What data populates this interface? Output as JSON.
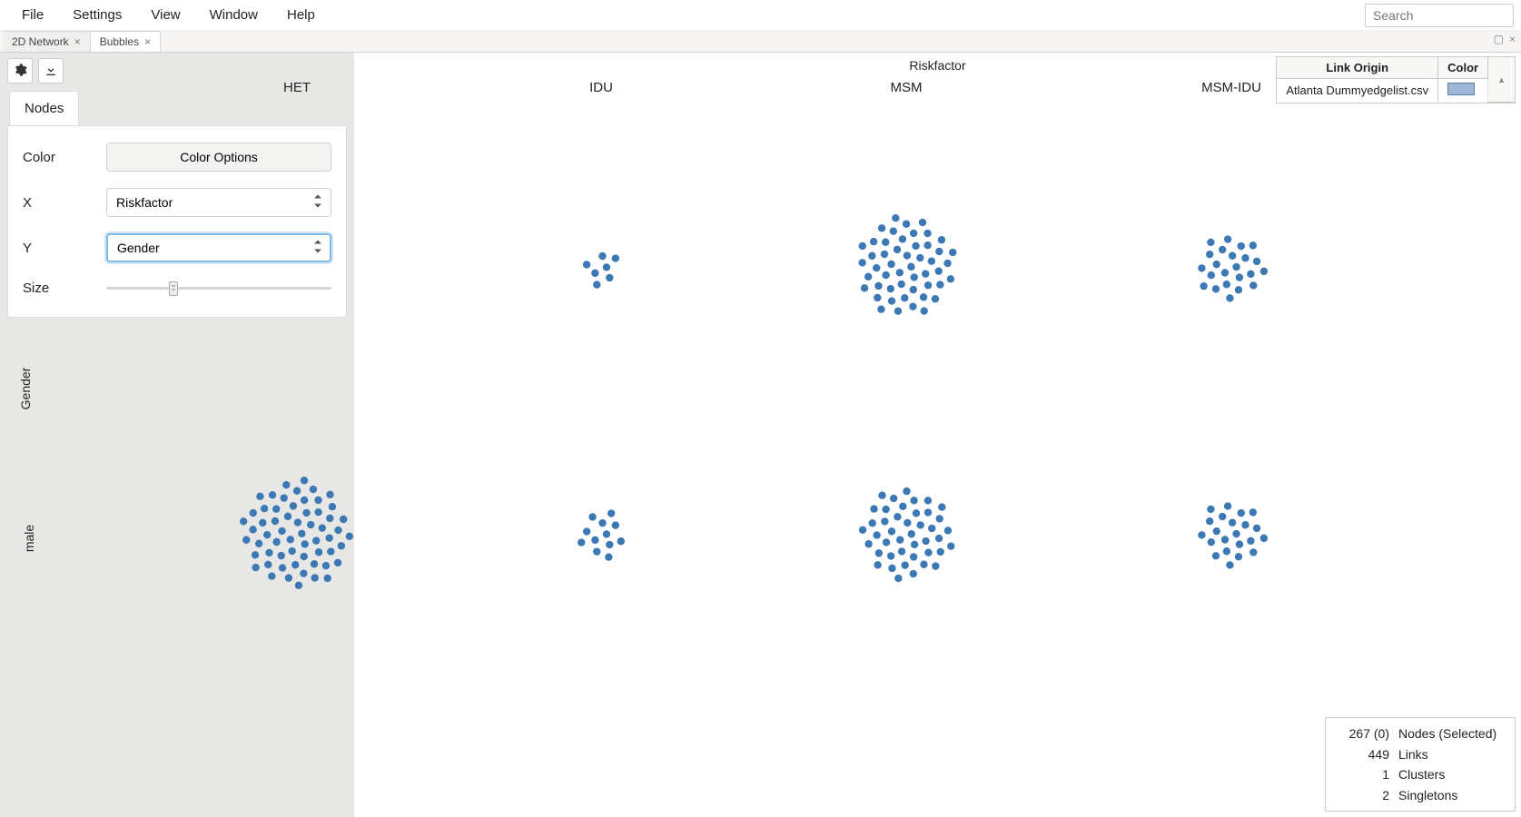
{
  "menu": {
    "items": [
      "File",
      "Settings",
      "View",
      "Window",
      "Help"
    ]
  },
  "search": {
    "placeholder": "Search"
  },
  "tabs": [
    {
      "label": "2D Network",
      "active": false
    },
    {
      "label": "Bubbles",
      "active": true
    }
  ],
  "panel": {
    "tab": "Nodes",
    "color_label": "Color",
    "color_button": "Color Options",
    "x_label": "X",
    "x_value": "Riskfactor",
    "y_label": "Y",
    "y_value": "Gender",
    "size_label": "Size"
  },
  "axes": {
    "x_title": "Riskfactor",
    "x_categories": [
      "HET",
      "IDU",
      "MSM",
      "MSM-IDU"
    ],
    "y_title": "Gender",
    "y_categories": [
      "male"
    ]
  },
  "chart_data": {
    "type": "bubble-grid",
    "x_field": "Riskfactor",
    "y_field": "Gender",
    "node_color": "#3c78b4",
    "cells": [
      {
        "x": "HET",
        "y": "",
        "count": 0
      },
      {
        "x": "IDU",
        "y": "",
        "count": 7
      },
      {
        "x": "MSM",
        "y": "",
        "count": 50
      },
      {
        "x": "MSM-IDU",
        "y": "",
        "count": 23
      },
      {
        "x": "HET",
        "y": "male",
        "count": 60
      },
      {
        "x": "IDU",
        "y": "male",
        "count": 12
      },
      {
        "x": "MSM",
        "y": "male",
        "count": 43
      },
      {
        "x": "MSM-IDU",
        "y": "male",
        "count": 22
      }
    ]
  },
  "legend": {
    "col_origin": "Link Origin",
    "col_color": "Color",
    "rows": [
      {
        "origin": "Atlanta Dummyedgelist.csv",
        "color": "#9fb7d6"
      }
    ]
  },
  "stats": {
    "nodes_count": "267 (0)",
    "nodes_label": "Nodes (Selected)",
    "links_count": "449",
    "links_label": "Links",
    "clusters_count": "1",
    "clusters_label": "Clusters",
    "singletons_count": "2",
    "singletons_label": "Singletons"
  }
}
